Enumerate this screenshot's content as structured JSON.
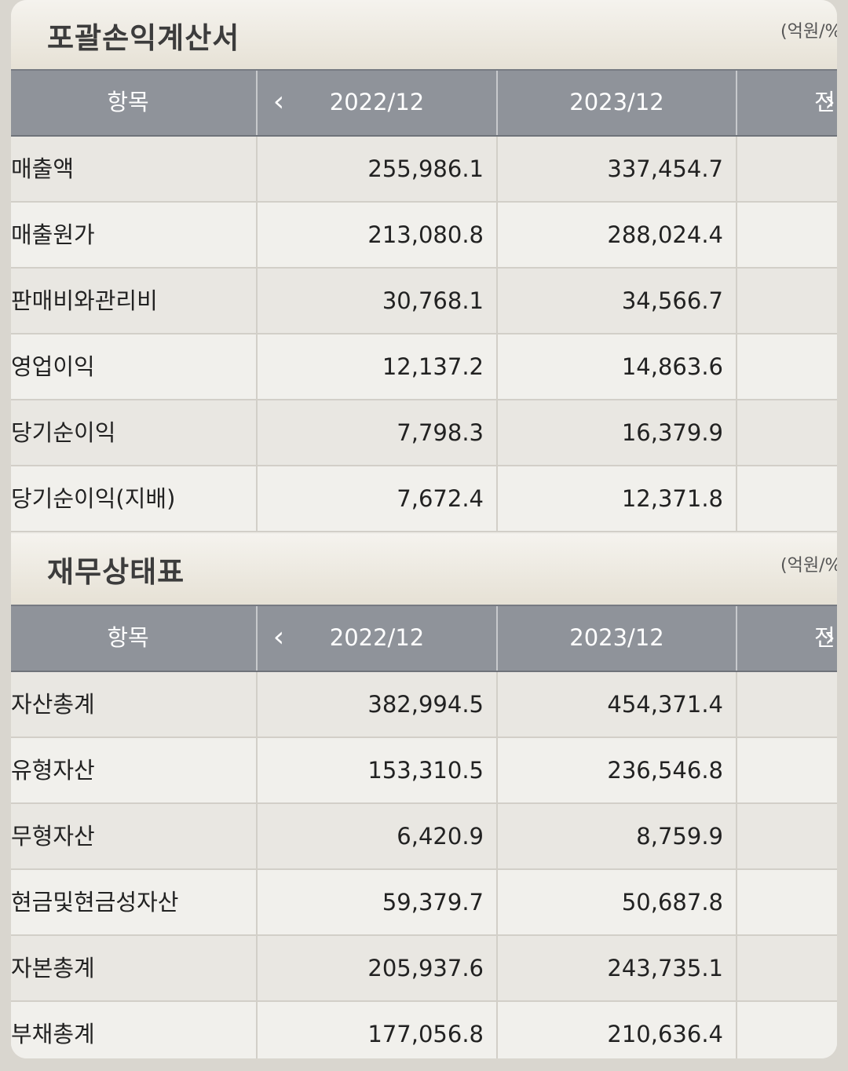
{
  "income_statement": {
    "title": "포괄손익계산서",
    "unit": "(억원/%)",
    "header": {
      "item": "항목",
      "periods": [
        "2022/12",
        "2023/12"
      ],
      "next_partial": "전년"
    },
    "rows": [
      {
        "label": "매출액",
        "v2022": "255,986.1",
        "v2023": "337,454.7"
      },
      {
        "label": "매출원가",
        "v2022": "213,080.8",
        "v2023": "288,024.4"
      },
      {
        "label": "판매비와관리비",
        "v2022": "30,768.1",
        "v2023": "34,566.7"
      },
      {
        "label": "영업이익",
        "v2022": "12,137.2",
        "v2023": "14,863.6"
      },
      {
        "label": "당기순이익",
        "v2022": "7,798.3",
        "v2023": "16,379.9"
      },
      {
        "label": "당기순이익(지배)",
        "v2022": "7,672.4",
        "v2023": "12,371.8"
      }
    ]
  },
  "balance_sheet": {
    "title": "재무상태표",
    "unit": "(억원/%)",
    "header": {
      "item": "항목",
      "periods": [
        "2022/12",
        "2023/12"
      ],
      "next_partial": "전년"
    },
    "rows": [
      {
        "label": "자산총계",
        "v2022": "382,994.5",
        "v2023": "454,371.4"
      },
      {
        "label": "유형자산",
        "v2022": "153,310.5",
        "v2023": "236,546.8"
      },
      {
        "label": "무형자산",
        "v2022": "6,420.9",
        "v2023": "8,759.9"
      },
      {
        "label": "현금및현금성자산",
        "v2022": "59,379.7",
        "v2023": "50,687.8"
      },
      {
        "label": "자본총계",
        "v2022": "205,937.6",
        "v2023": "243,735.1"
      },
      {
        "label": "부채총계",
        "v2022": "177,056.8",
        "v2023": "210,636.4"
      }
    ]
  },
  "icons": {
    "prev": "chevron-left-icon",
    "next": "chevron-right-icon"
  }
}
